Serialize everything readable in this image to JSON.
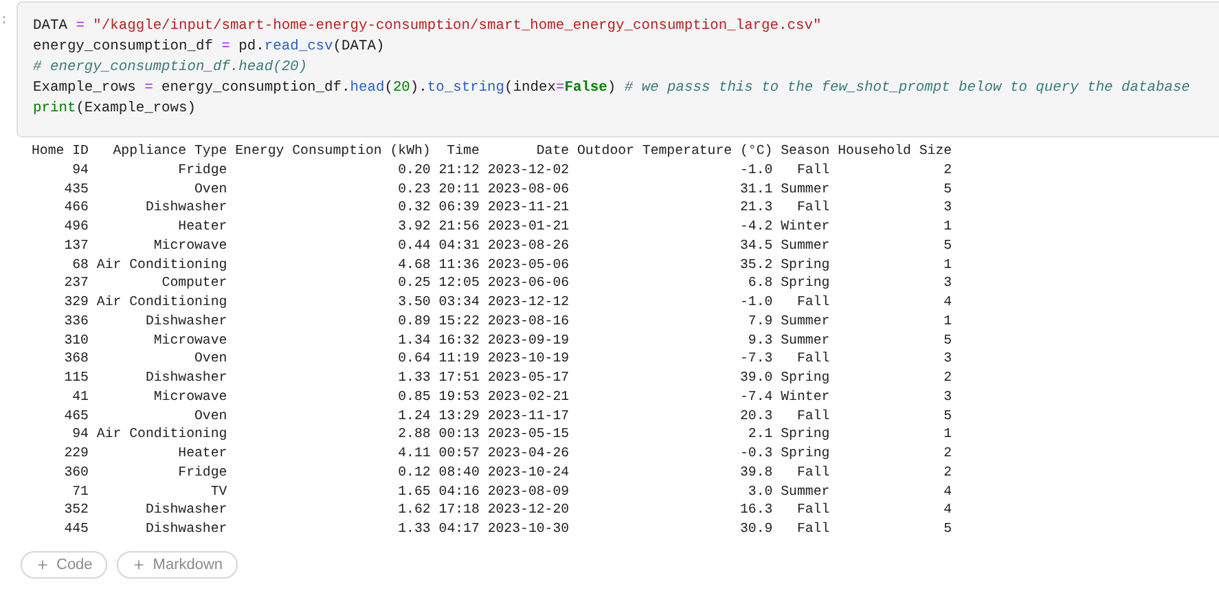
{
  "code_cell": {
    "prompt": ":",
    "lines": [
      [
        {
          "kind": "plain",
          "text": "DATA "
        },
        {
          "kind": "operator",
          "text": "="
        },
        {
          "kind": "string",
          "text": " \"/kaggle/input/smart-home-energy-consumption/smart_home_energy_consumption_large.csv\""
        }
      ],
      [
        {
          "kind": "plain",
          "text": "energy_consumption_df "
        },
        {
          "kind": "operator",
          "text": "="
        },
        {
          "kind": "plain",
          "text": " pd."
        },
        {
          "kind": "func",
          "text": "read_csv"
        },
        {
          "kind": "plain",
          "text": "(DATA)"
        }
      ],
      [
        {
          "kind": "comment",
          "text": "# energy_consumption_df.head(20)"
        }
      ],
      [
        {
          "kind": "plain",
          "text": "Example_rows "
        },
        {
          "kind": "operator",
          "text": "="
        },
        {
          "kind": "plain",
          "text": " energy_consumption_df."
        },
        {
          "kind": "func",
          "text": "head"
        },
        {
          "kind": "plain",
          "text": "("
        },
        {
          "kind": "number",
          "text": "20"
        },
        {
          "kind": "plain",
          "text": ")."
        },
        {
          "kind": "func",
          "text": "to_string"
        },
        {
          "kind": "plain",
          "text": "(index"
        },
        {
          "kind": "operator",
          "text": "="
        },
        {
          "kind": "keyword",
          "text": "False"
        },
        {
          "kind": "plain",
          "text": ") "
        },
        {
          "kind": "comment",
          "text": "# we passs this to the few_shot_prompt below to query the database"
        }
      ],
      [
        {
          "kind": "builtin",
          "text": "print"
        },
        {
          "kind": "plain",
          "text": "(Example_rows)"
        }
      ]
    ]
  },
  "output_table": {
    "columns": [
      "Home ID",
      "Appliance Type",
      "Energy Consumption (kWh)",
      "Time",
      "Date",
      "Outdoor Temperature (°C)",
      "Season",
      "Household Size"
    ],
    "rows": [
      [
        "94",
        "Fridge",
        "0.20",
        "21:12",
        "2023-12-02",
        "-1.0",
        "Fall",
        "2"
      ],
      [
        "435",
        "Oven",
        "0.23",
        "20:11",
        "2023-08-06",
        "31.1",
        "Summer",
        "5"
      ],
      [
        "466",
        "Dishwasher",
        "0.32",
        "06:39",
        "2023-11-21",
        "21.3",
        "Fall",
        "3"
      ],
      [
        "496",
        "Heater",
        "3.92",
        "21:56",
        "2023-01-21",
        "-4.2",
        "Winter",
        "1"
      ],
      [
        "137",
        "Microwave",
        "0.44",
        "04:31",
        "2023-08-26",
        "34.5",
        "Summer",
        "5"
      ],
      [
        "68",
        "Air Conditioning",
        "4.68",
        "11:36",
        "2023-05-06",
        "35.2",
        "Spring",
        "1"
      ],
      [
        "237",
        "Computer",
        "0.25",
        "12:05",
        "2023-06-06",
        "6.8",
        "Spring",
        "3"
      ],
      [
        "329",
        "Air Conditioning",
        "3.50",
        "03:34",
        "2023-12-12",
        "-1.0",
        "Fall",
        "4"
      ],
      [
        "336",
        "Dishwasher",
        "0.89",
        "15:22",
        "2023-08-16",
        "7.9",
        "Summer",
        "1"
      ],
      [
        "310",
        "Microwave",
        "1.34",
        "16:32",
        "2023-09-19",
        "9.3",
        "Summer",
        "5"
      ],
      [
        "368",
        "Oven",
        "0.64",
        "11:19",
        "2023-10-19",
        "-7.3",
        "Fall",
        "3"
      ],
      [
        "115",
        "Dishwasher",
        "1.33",
        "17:51",
        "2023-05-17",
        "39.0",
        "Spring",
        "2"
      ],
      [
        "41",
        "Microwave",
        "0.85",
        "19:53",
        "2023-02-21",
        "-7.4",
        "Winter",
        "3"
      ],
      [
        "465",
        "Oven",
        "1.24",
        "13:29",
        "2023-11-17",
        "20.3",
        "Fall",
        "5"
      ],
      [
        "94",
        "Air Conditioning",
        "2.88",
        "00:13",
        "2023-05-15",
        "2.1",
        "Spring",
        "1"
      ],
      [
        "229",
        "Heater",
        "4.11",
        "00:57",
        "2023-04-26",
        "-0.3",
        "Spring",
        "2"
      ],
      [
        "360",
        "Fridge",
        "0.12",
        "08:40",
        "2023-10-24",
        "39.8",
        "Fall",
        "2"
      ],
      [
        "71",
        "TV",
        "1.65",
        "04:16",
        "2023-08-09",
        "3.0",
        "Summer",
        "4"
      ],
      [
        "352",
        "Dishwasher",
        "1.62",
        "17:18",
        "2023-12-20",
        "16.3",
        "Fall",
        "4"
      ],
      [
        "445",
        "Dishwasher",
        "1.33",
        "04:17",
        "2023-10-30",
        "30.9",
        "Fall",
        "5"
      ]
    ]
  },
  "add_buttons": [
    "Code",
    "Markdown"
  ]
}
